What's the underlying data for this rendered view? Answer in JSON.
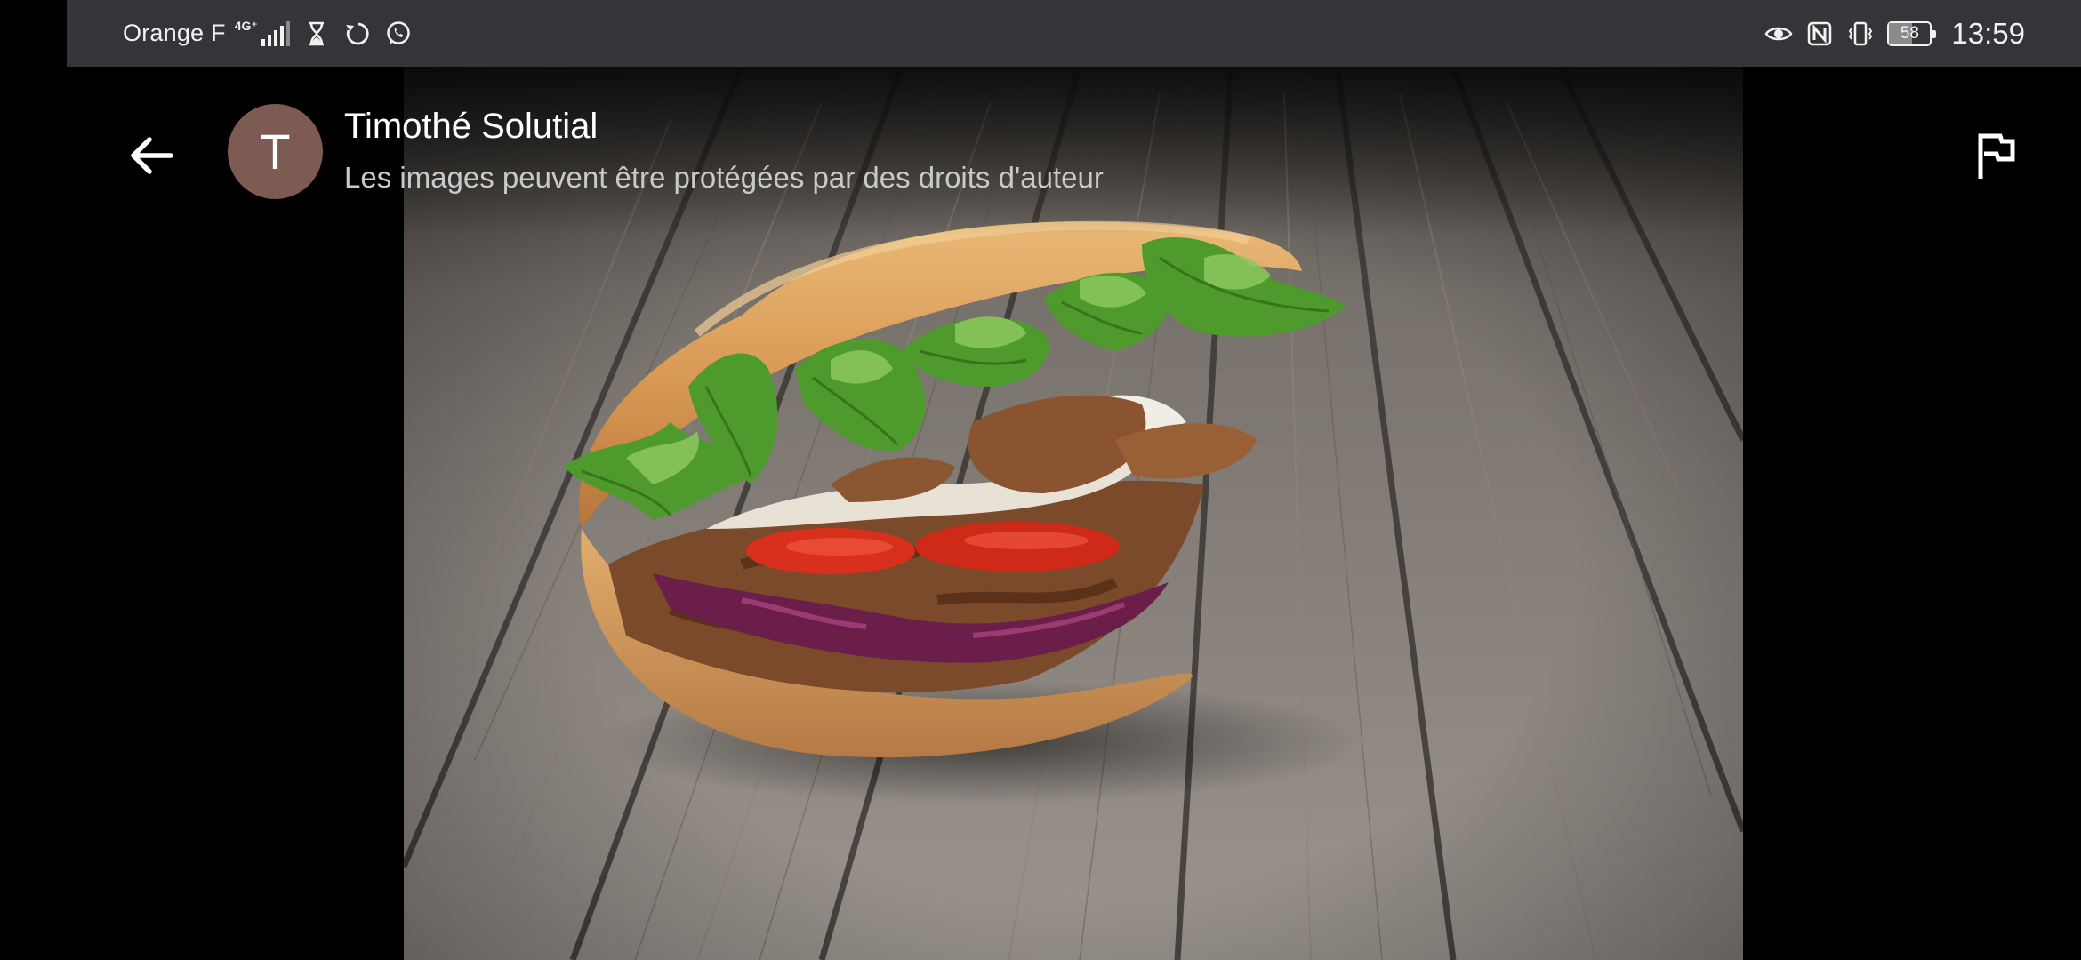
{
  "status_bar": {
    "carrier": "Orange F",
    "network_type": "4G⁺",
    "time": "13:59",
    "battery_level": "58",
    "icons": [
      "signal-icon",
      "hourglass-icon",
      "sync-icon",
      "whatsapp-icon",
      "eye-icon",
      "nfc-icon",
      "vibrate-icon",
      "battery-icon"
    ]
  },
  "header": {
    "avatar_letter": "T",
    "avatar_color": "#7d5b52",
    "sender_name": "Timothé Solutial",
    "copyright_note": "Les images peuvent être protégées par des droits d'auteur",
    "back_icon": "arrow-back-icon",
    "report_icon": "flag-icon"
  },
  "image": {
    "subject": "kebab-photo"
  }
}
